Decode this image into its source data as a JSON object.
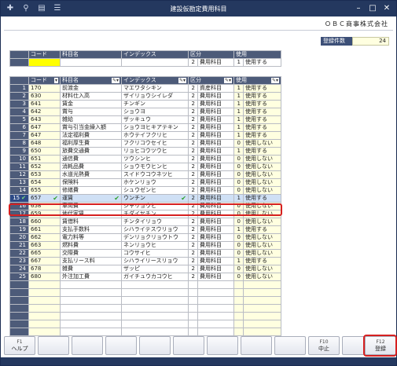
{
  "window": {
    "title": "建設仮勘定費用科目"
  },
  "toolbar": {
    "icons": [
      "add-icon",
      "search-icon",
      "print-icon",
      "list-icon"
    ]
  },
  "company": "ＯＢＣ商事株式会社",
  "count": {
    "label": "登録件数",
    "value": "24"
  },
  "columns": {
    "code": "コード",
    "name": "科目名",
    "index": "インデックス",
    "kubun": "区分",
    "use": "使用"
  },
  "new_row": {
    "code": "",
    "name": "",
    "index": "",
    "kubun_num": "2",
    "kubun": "費用科目",
    "use_num": "1",
    "use": "使用する"
  },
  "rows": [
    {
      "no": "1",
      "code": "170",
      "name": "前渡金",
      "index": "マエワタシキン",
      "kn": "2",
      "kubun": "資産科目",
      "un": "1",
      "use": "使用する"
    },
    {
      "no": "2",
      "code": "630",
      "name": "材料仕入高",
      "index": "ザイリョウシイレダ",
      "kn": "2",
      "kubun": "費用科目",
      "un": "1",
      "use": "使用する"
    },
    {
      "no": "3",
      "code": "641",
      "name": "賃金",
      "index": "チンギン",
      "kn": "2",
      "kubun": "費用科目",
      "un": "1",
      "use": "使用する"
    },
    {
      "no": "4",
      "code": "642",
      "name": "賞与",
      "index": "ショウヨ",
      "kn": "2",
      "kubun": "費用科目",
      "un": "1",
      "use": "使用する"
    },
    {
      "no": "5",
      "code": "643",
      "name": "雑給",
      "index": "ザッキュウ",
      "kn": "2",
      "kubun": "費用科目",
      "un": "1",
      "use": "使用する"
    },
    {
      "no": "6",
      "code": "647",
      "name": "賞与引当金繰入額",
      "index": "ショウヨヒキアテキン",
      "kn": "2",
      "kubun": "費用科目",
      "un": "1",
      "use": "使用する"
    },
    {
      "no": "7",
      "code": "647",
      "name": "法定福利費",
      "index": "ホウテイフクリヒ",
      "kn": "2",
      "kubun": "費用科目",
      "un": "1",
      "use": "使用する"
    },
    {
      "no": "8",
      "code": "648",
      "name": "福利厚生費",
      "index": "フクリコウセイヒ",
      "kn": "2",
      "kubun": "費用科目",
      "un": "0",
      "use": "使用しない"
    },
    {
      "no": "9",
      "code": "650",
      "name": "旅費交通費",
      "index": "リョヒコウツウヒ",
      "kn": "2",
      "kubun": "費用科目",
      "un": "1",
      "use": "使用する"
    },
    {
      "no": "10",
      "code": "651",
      "name": "通信費",
      "index": "ツウシンヒ",
      "kn": "2",
      "kubun": "費用科目",
      "un": "0",
      "use": "使用しない"
    },
    {
      "no": "11",
      "code": "652",
      "name": "消耗品費",
      "index": "ショウモウヒンヒ",
      "kn": "2",
      "kubun": "費用科目",
      "un": "0",
      "use": "使用しない"
    },
    {
      "no": "12",
      "code": "653",
      "name": "水道光熱費",
      "index": "スイドウコウネツヒ",
      "kn": "2",
      "kubun": "費用科目",
      "un": "0",
      "use": "使用しない"
    },
    {
      "no": "13",
      "code": "654",
      "name": "保険料",
      "index": "ホケンリョウ",
      "kn": "2",
      "kubun": "費用科目",
      "un": "0",
      "use": "使用しない"
    },
    {
      "no": "14",
      "code": "655",
      "name": "修繕費",
      "index": "シュウゼンヒ",
      "kn": "2",
      "kubun": "費用科目",
      "un": "0",
      "use": "使用しない"
    },
    {
      "no": "15",
      "code": "657",
      "name": "運賃",
      "index": "ウンチン",
      "kn": "2",
      "kubun": "費用科目",
      "un": "1",
      "use": "使用する",
      "selected": true
    },
    {
      "no": "16",
      "code": "658",
      "name": "車両費",
      "index": "シャリョウヒ",
      "kn": "2",
      "kubun": "費用科目",
      "un": "0",
      "use": "使用しない"
    },
    {
      "no": "17",
      "code": "659",
      "name": "地代家賃",
      "index": "チダイヤチン",
      "kn": "2",
      "kubun": "費用科目",
      "un": "0",
      "use": "使用しない"
    },
    {
      "no": "18",
      "code": "660",
      "name": "賃借料",
      "index": "チンタイリョウ",
      "kn": "2",
      "kubun": "費用科目",
      "un": "0",
      "use": "使用しない"
    },
    {
      "no": "19",
      "code": "661",
      "name": "支払手数料",
      "index": "シハライテスウリョウ",
      "kn": "2",
      "kubun": "費用科目",
      "un": "1",
      "use": "使用する"
    },
    {
      "no": "20",
      "code": "662",
      "name": "電力料等",
      "index": "デンリョクリョウトウ",
      "kn": "2",
      "kubun": "費用科目",
      "un": "0",
      "use": "使用しない"
    },
    {
      "no": "21",
      "code": "663",
      "name": "燃料費",
      "index": "ネンリョウヒ",
      "kn": "2",
      "kubun": "費用科目",
      "un": "0",
      "use": "使用しない"
    },
    {
      "no": "22",
      "code": "665",
      "name": "交際費",
      "index": "コウサイヒ",
      "kn": "2",
      "kubun": "費用科目",
      "un": "0",
      "use": "使用しない"
    },
    {
      "no": "23",
      "code": "667",
      "name": "支払リース料",
      "index": "シハライリースリョウ",
      "kn": "2",
      "kubun": "費用科目",
      "un": "1",
      "use": "使用する"
    },
    {
      "no": "24",
      "code": "678",
      "name": "雑費",
      "index": "ザッピ",
      "kn": "2",
      "kubun": "費用科目",
      "un": "0",
      "use": "使用しない"
    },
    {
      "no": "25",
      "code": "680",
      "name": "外注加工費",
      "index": "ガイチュウカコウヒ",
      "kn": "2",
      "kubun": "費用科目",
      "un": "0",
      "use": "使用しない"
    },
    {
      "no": "",
      "code": "",
      "name": "",
      "index": "",
      "kn": "",
      "kubun": "",
      "un": "",
      "use": ""
    },
    {
      "no": "",
      "code": "",
      "name": "",
      "index": "",
      "kn": "",
      "kubun": "",
      "un": "",
      "use": ""
    },
    {
      "no": "",
      "code": "",
      "name": "",
      "index": "",
      "kn": "",
      "kubun": "",
      "un": "",
      "use": ""
    },
    {
      "no": "",
      "code": "",
      "name": "",
      "index": "",
      "kn": "",
      "kubun": "",
      "un": "",
      "use": ""
    },
    {
      "no": "",
      "code": "",
      "name": "",
      "index": "",
      "kn": "",
      "kubun": "",
      "un": "",
      "use": ""
    },
    {
      "no": "",
      "code": "",
      "name": "",
      "index": "",
      "kn": "",
      "kubun": "",
      "un": "",
      "use": ""
    },
    {
      "no": "",
      "code": "",
      "name": "",
      "index": "",
      "kn": "",
      "kubun": "",
      "un": "",
      "use": ""
    }
  ],
  "fkeys": [
    {
      "key": "F1",
      "label": "ヘルプ"
    },
    {
      "key": "",
      "label": ""
    },
    {
      "key": "",
      "label": ""
    },
    {
      "key": "",
      "label": ""
    },
    {
      "key": "",
      "label": ""
    },
    {
      "key": "",
      "label": ""
    },
    {
      "key": "",
      "label": ""
    },
    {
      "key": "",
      "label": ""
    },
    {
      "key": "",
      "label": ""
    },
    {
      "key": "F10",
      "label": "中止"
    },
    {
      "key": "",
      "label": ""
    },
    {
      "key": "F12",
      "label": "登録"
    }
  ]
}
